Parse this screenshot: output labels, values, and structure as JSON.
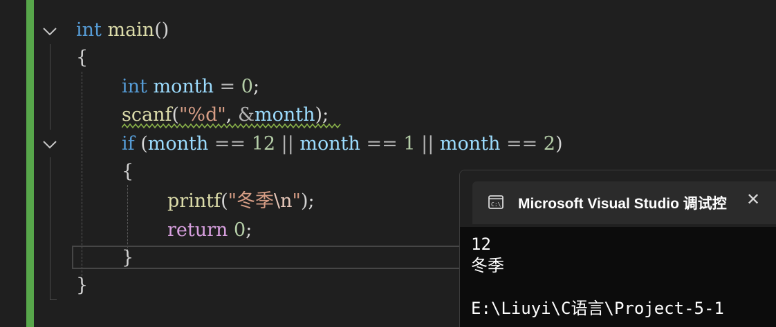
{
  "code": {
    "line1": {
      "kw": "int",
      "fn": "main",
      "paren": "()"
    },
    "line2": "{",
    "line3": {
      "kw": "int",
      "var": "month",
      "op": " = ",
      "num": "0",
      "semi": ";"
    },
    "line4": {
      "fn": "scanf",
      "open": "(",
      "str": "\"%d\"",
      "comma": ", ",
      "amp": "&",
      "var": "month",
      "close": ")",
      "semi": ";"
    },
    "line5": {
      "kw": "if",
      "open": " (",
      "v1": "month",
      "op1": " == ",
      "n1": "12",
      "or1": " || ",
      "v2": "month",
      "op2": " == ",
      "n2": "1",
      "or2": " || ",
      "v3": "month",
      "op3": " == ",
      "n3": "2",
      "close": ")"
    },
    "line6": "{",
    "line7": {
      "fn": "printf",
      "open": "(",
      "q1": "\"冬季",
      "esc": "\\n",
      "q2": "\"",
      "close": ")",
      "semi": ";"
    },
    "line8": {
      "kw": "return",
      "num": "0",
      "semi": ";"
    },
    "line9": "}",
    "line10": "}"
  },
  "console": {
    "title": "Microsoft Visual Studio 调试控",
    "close_glyph": "✕",
    "icon": "console-app-icon",
    "lines": [
      "12",
      "冬季",
      "",
      "E:\\Liuyi\\C语言\\Project-5-1"
    ]
  },
  "colors": {
    "keyword": "#569cd6",
    "function": "#dcdcaa",
    "variable": "#9cdcfe",
    "number": "#b5cea8",
    "string": "#d69d85",
    "change_bar": "#57a64a"
  }
}
